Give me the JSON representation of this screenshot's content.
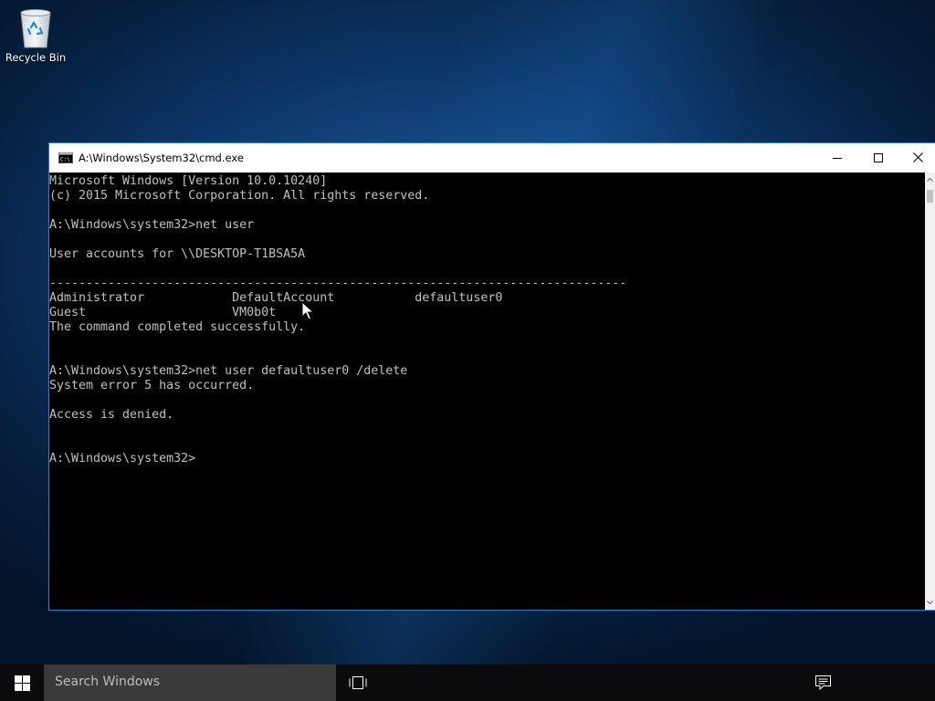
{
  "desktop": {
    "recycle_bin_label": "Recycle Bin"
  },
  "cmd_window": {
    "title": "A:\\Windows\\System32\\cmd.exe",
    "icon": "console-icon",
    "controls": {
      "minimize_icon": "minimize-icon",
      "maximize_icon": "maximize-icon",
      "close_icon": "close-icon"
    },
    "console_text": "Microsoft Windows [Version 10.0.10240]\n(c) 2015 Microsoft Corporation. All rights reserved.\n\nA:\\Windows\\system32>net user\n\nUser accounts for \\\\DESKTOP-T1BSA5A\n\n-------------------------------------------------------------------------------\nAdministrator            DefaultAccount           defaultuser0\nGuest                    VM0b0t\nThe command completed successfully.\n\n\nA:\\Windows\\system32>net user defaultuser0 /delete\nSystem error 5 has occurred.\n\nAccess is denied.\n\n\nA:\\Windows\\system32>",
    "colors": {
      "console_background": "#000000",
      "console_text": "#c0c0c0",
      "window_border": "#2f7fc6"
    }
  },
  "taskbar": {
    "start_icon": "windows-logo-icon",
    "search_placeholder": "Search Windows",
    "task_view_icon": "task-view-icon",
    "action_center_icon": "action-center-icon"
  }
}
